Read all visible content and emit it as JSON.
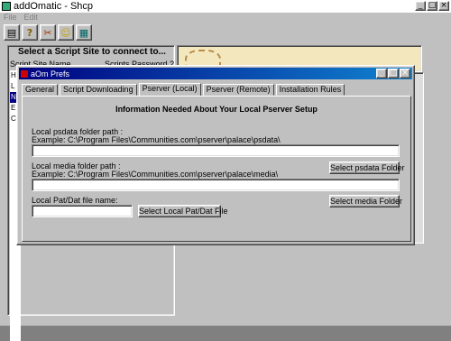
{
  "window": {
    "title": "addOmatic - Shcp"
  },
  "menu": [
    "File",
    "Edit"
  ],
  "toolbar_icons": [
    "scripts-icon",
    "help-icon",
    "tools-icon",
    "smile-icon",
    "grid-icon"
  ],
  "left_panel": {
    "heading": "Select a Script Site to connect to...",
    "col_site": "Script Site Name",
    "col_password": "Scripts Password ?",
    "list_letters": [
      "H",
      "L",
      "N",
      "E",
      "C"
    ]
  },
  "dialog": {
    "title": "aOm Prefs",
    "tabs": [
      "General",
      "Script Downloading",
      "Pserver (Local)",
      "Pserver (Remote)",
      "Installation Rules"
    ],
    "active_tab": "Pserver (Local)",
    "heading": "Information Needed About Your Local Pserver Setup",
    "psdata": {
      "label": "Local psdata folder path :",
      "example": "Example: C:\\Program Files\\Communities.com\\pserver\\palace\\psdata\\",
      "value": "",
      "button": "Select psdata Folder"
    },
    "media": {
      "label": "Local media folder path :",
      "example": "Example: C:\\Program Files\\Communities.com\\pserver\\palace\\media\\",
      "value": "",
      "button": "Select media Folder"
    },
    "patdat": {
      "label": "Local Pat/Dat file name:",
      "value": "",
      "button": "Select Local Pat/Dat File"
    }
  }
}
